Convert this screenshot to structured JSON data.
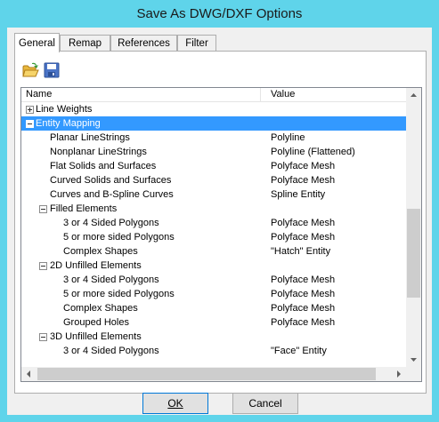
{
  "window": {
    "title": "Save As DWG/DXF Options"
  },
  "tabs": [
    {
      "label": "General",
      "active": true
    },
    {
      "label": "Remap",
      "active": false
    },
    {
      "label": "References",
      "active": false
    },
    {
      "label": "Filter",
      "active": false
    }
  ],
  "toolbar": {
    "open_icon": "open-folder-icon",
    "save_icon": "floppy-disk-icon"
  },
  "grid": {
    "columns": [
      "Name",
      "Value"
    ],
    "rows": [
      {
        "name": "Line Weights",
        "value": "",
        "toggle": "plus"
      },
      {
        "name": "Entity Mapping",
        "value": "",
        "toggle": "minus",
        "selected": true
      },
      {
        "name": "Planar LineStrings",
        "value": "Polyline"
      },
      {
        "name": "Nonplanar LineStrings",
        "value": "Polyline (Flattened)"
      },
      {
        "name": "Flat Solids and Surfaces",
        "value": "Polyface Mesh"
      },
      {
        "name": "Curved Solids and Surfaces",
        "value": "Polyface Mesh"
      },
      {
        "name": "Curves and B-Spline Curves",
        "value": "Spline Entity"
      },
      {
        "name": "Filled Elements",
        "value": "",
        "toggle": "minus"
      },
      {
        "name": "3 or 4 Sided Polygons",
        "value": "Polyface Mesh"
      },
      {
        "name": "5 or more sided Polygons",
        "value": "Polyface Mesh"
      },
      {
        "name": "Complex Shapes",
        "value": "\"Hatch\" Entity"
      },
      {
        "name": "2D Unfilled Elements",
        "value": "",
        "toggle": "minus"
      },
      {
        "name": "3 or 4 Sided Polygons",
        "value": "Polyface Mesh"
      },
      {
        "name": "5 or more sided Polygons",
        "value": "Polyface Mesh"
      },
      {
        "name": "Complex Shapes",
        "value": "Polyface Mesh"
      },
      {
        "name": "Grouped Holes",
        "value": "Polyface Mesh"
      },
      {
        "name": "3D Unfilled Elements",
        "value": "",
        "toggle": "minus"
      },
      {
        "name": "3 or 4 Sided Polygons",
        "value": "\"Face\" Entity"
      }
    ]
  },
  "buttons": {
    "ok": "OK",
    "cancel": "Cancel"
  },
  "colors": {
    "title_bar": "#5fd4ea",
    "selection": "#3399ff"
  }
}
